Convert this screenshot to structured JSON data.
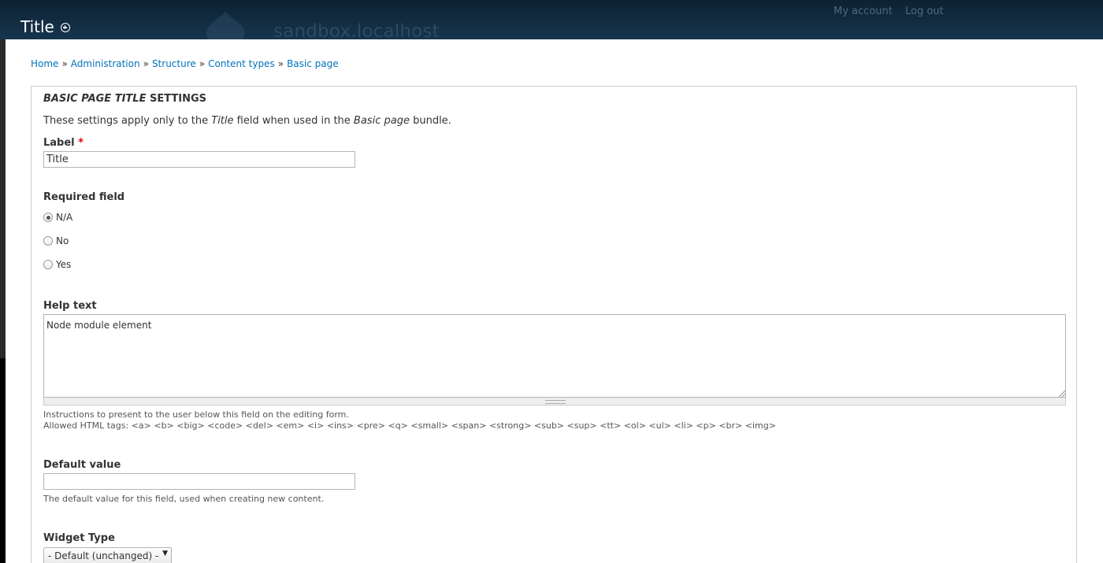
{
  "overlay": {
    "title": "Title"
  },
  "site": {
    "name": "sandbox.localhost"
  },
  "user_links": {
    "account": "My account",
    "logout": "Log out"
  },
  "breadcrumb": [
    {
      "label": "Home"
    },
    {
      "label": "Administration"
    },
    {
      "label": "Structure"
    },
    {
      "label": "Content types"
    },
    {
      "label": "Basic page"
    }
  ],
  "breadcrumb_separator": "»",
  "settings": {
    "title_italic": "BASIC PAGE TITLE",
    "title_rest": " SETTINGS",
    "desc_pre": "These settings apply only to the ",
    "desc_field": "Title",
    "desc_mid": " field when used in the ",
    "desc_bundle": "Basic page",
    "desc_post": " bundle."
  },
  "label_field": {
    "label": "Label",
    "required_mark": "*",
    "value": "Title"
  },
  "required_field": {
    "label": "Required field",
    "options": [
      {
        "label": "N/A",
        "checked": true
      },
      {
        "label": "No",
        "checked": false
      },
      {
        "label": "Yes",
        "checked": false
      }
    ]
  },
  "help_text": {
    "label": "Help text",
    "value": "Node module element",
    "description_1": "Instructions to present to the user below this field on the editing form.",
    "description_2": "Allowed HTML tags: <a> <b> <big> <code> <del> <em> <i> <ins> <pre> <q> <small> <span> <strong> <sub> <sup> <tt> <ol> <ul> <li> <p> <br> <img>"
  },
  "default_value": {
    "label": "Default value",
    "value": "",
    "description": "The default value for this field, used when creating new content."
  },
  "widget_type": {
    "label": "Widget Type",
    "selected": "- Default (unchanged) -"
  }
}
